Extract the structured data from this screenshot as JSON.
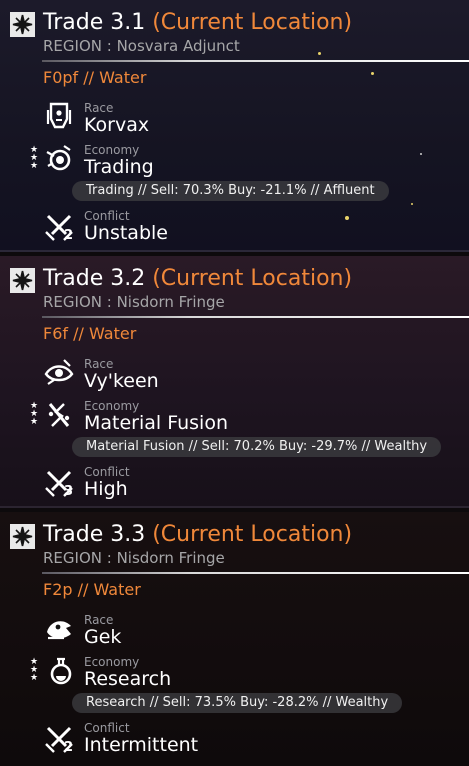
{
  "systems": [
    {
      "title": "Trade 3.1",
      "location_tag": "(Current Location)",
      "region": "REGION : Nosvara Adjunct",
      "planet_class": "F0pf // Water",
      "race": {
        "label": "Race",
        "value": "Korvax",
        "icon": "korvax-race-icon"
      },
      "economy": {
        "label": "Economy",
        "value": "Trading",
        "detail": "Trading // Sell: 70.3% Buy: -21.1% // Affluent",
        "icon": "trading-economy-icon",
        "wealth_stars": 3
      },
      "conflict": {
        "label": "Conflict",
        "value": "Unstable",
        "level": "2",
        "icon": "crossed-swords-icon"
      }
    },
    {
      "title": "Trade 3.2",
      "location_tag": "(Current Location)",
      "region": "REGION : Nisdorn Fringe",
      "planet_class": "F6f // Water",
      "race": {
        "label": "Race",
        "value": "Vy'keen",
        "icon": "vykeen-race-icon"
      },
      "economy": {
        "label": "Economy",
        "value": "Material Fusion",
        "detail": "Material Fusion // Sell: 70.2% Buy: -29.7% // Wealthy",
        "icon": "material-fusion-economy-icon",
        "wealth_stars": 3
      },
      "conflict": {
        "label": "Conflict",
        "value": "High",
        "level": "3",
        "icon": "crossed-swords-icon"
      }
    },
    {
      "title": "Trade 3.3",
      "location_tag": "(Current Location)",
      "region": "REGION : Nisdorn Fringe",
      "planet_class": "F2p // Water",
      "race": {
        "label": "Race",
        "value": "Gek",
        "icon": "gek-race-icon"
      },
      "economy": {
        "label": "Economy",
        "value": "Research",
        "detail": "Research // Sell: 73.5% Buy: -28.2% // Wealthy",
        "icon": "research-economy-icon",
        "wealth_stars": 3
      },
      "conflict": {
        "label": "Conflict",
        "value": "Intermittent",
        "level": "2",
        "icon": "crossed-swords-icon"
      }
    }
  ],
  "colors": {
    "accent": "#f0883a",
    "muted": "#a6a6a8"
  }
}
